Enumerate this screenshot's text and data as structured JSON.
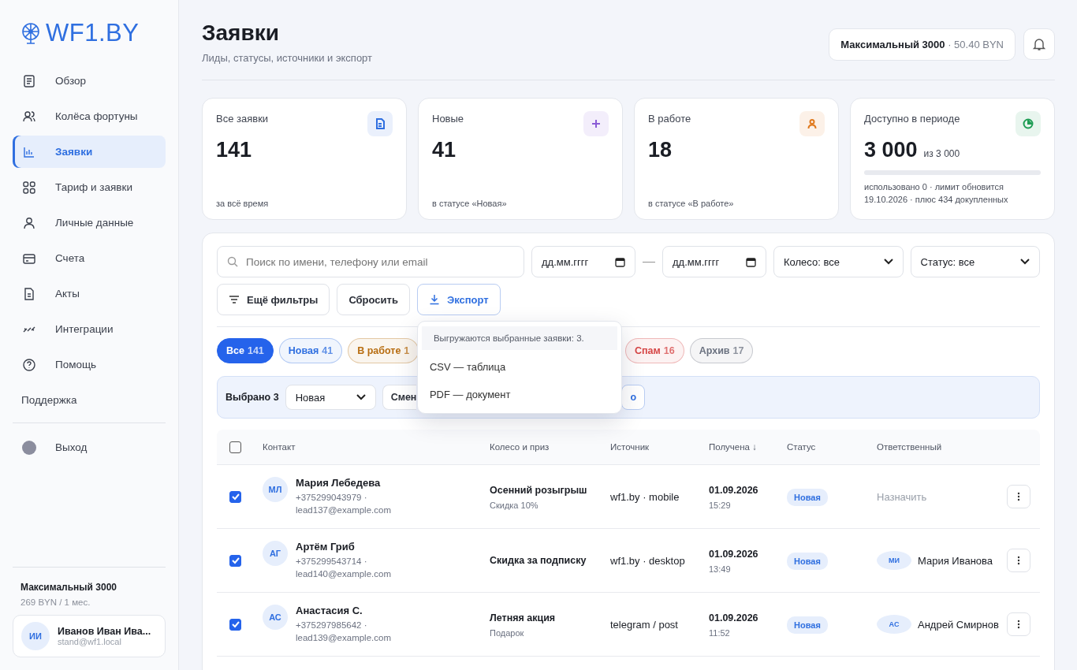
{
  "logo": "WF1.BY",
  "nav": [
    {
      "label": "Обзор",
      "selected": false
    },
    {
      "label": "Колёса фортуны",
      "selected": false
    },
    {
      "label": "Заявки",
      "selected": true
    },
    {
      "label": "Тариф и заявки",
      "selected": false
    },
    {
      "label": "Личные данные",
      "selected": false
    },
    {
      "label": "Счета",
      "selected": false
    },
    {
      "label": "Акты",
      "selected": false
    },
    {
      "label": "Интеграции",
      "selected": false
    },
    {
      "label": "Помощь",
      "selected": false
    }
  ],
  "support": "Поддержка",
  "logout": "Выход",
  "plan": {
    "name": "Максимальный 3000",
    "price": "269 BYN / 1 мес."
  },
  "user": {
    "initials": "ИИ",
    "name": "Иванов Иван Ива...",
    "email": "stand@wf1.local"
  },
  "header": {
    "title": "Заявки",
    "subtitle": "Лиды, статусы, источники и экспорт",
    "plan": "Максимальный 3000",
    "balance": "· 50.40 BYN"
  },
  "stats": [
    {
      "label": "Все заявки",
      "value": "141",
      "note": "за всё время",
      "color": "#2f6fe0"
    },
    {
      "label": "Новые",
      "value": "41",
      "note": "в статусе «Новая»",
      "color": "#8a5cd6"
    },
    {
      "label": "В работе",
      "value": "18",
      "note": "в статусе «В работе»",
      "color": "#e07a1f"
    },
    {
      "label": "Доступно в периоде",
      "value": "3 000",
      "suffix": "из 3 000",
      "level": 0,
      "note": "использовано 0 · лимит обновится 19.10.2026 · плюс 434 докупленных",
      "color": "#1f9d55"
    }
  ],
  "filters": {
    "search_placeholder": "Поиск по имени, телефону или email",
    "date_from": "дд.мм.гггг",
    "date_separator": "—",
    "date_to": "дд.мм.гггг",
    "wheel": "Колесо: все",
    "status": "Статус: все",
    "more": "Ещё фильтры",
    "reset": "Сбросить",
    "export": "Экспорт"
  },
  "export_menu": {
    "hint": "Выгружаются выбранные заявки: 3.",
    "items": [
      "CSV — таблица",
      "PDF — документ"
    ]
  },
  "chips_left": [
    {
      "label": "Все",
      "count": "141",
      "selected": true,
      "color": "#2563eb"
    },
    {
      "label": "Новая",
      "count": "41",
      "selected": false,
      "color": "#2f6fe0"
    },
    {
      "label": "В работе",
      "count": "1",
      "selected": false,
      "color": "#b86e12"
    }
  ],
  "chips_right": [
    {
      "label": "Спам",
      "count": "16",
      "selected": false,
      "color": "#d64545"
    },
    {
      "label": "Архив",
      "count": "17",
      "selected": false,
      "color": "#6b7280"
    }
  ],
  "bulk": {
    "label": "Выбрано 3",
    "status": "Новая",
    "button_left": "Смен",
    "button_right": "о"
  },
  "table": {
    "columns": [
      "Контакт",
      "Колесо и приз",
      "Источник",
      "Получена ↓",
      "Статус",
      "Ответственный"
    ],
    "all_checked": false,
    "rows": [
      {
        "checked": true,
        "initials": "МЛ",
        "name": "Мария Лебедева",
        "phone": "+375299043979 ·",
        "email": "lead137@example.com",
        "wheel": "Осенний розыгрыш",
        "prize": "Скидка 10%",
        "source": "wf1.by · mobile",
        "date": "01.09.2026",
        "time": "15:29",
        "status": "Новая",
        "owner": {
          "kind": "assign",
          "label": "Назначить"
        }
      },
      {
        "checked": true,
        "initials": "АГ",
        "name": "Артём Гриб",
        "phone": "+375299543714 ·",
        "email": "lead140@example.com",
        "wheel": "Скидка за подписку",
        "source": "wf1.by · desktop",
        "date": "01.09.2026",
        "time": "13:49",
        "status": "Новая",
        "owner": {
          "kind": "person",
          "initials": "МИ",
          "label": "Мария Иванова"
        }
      },
      {
        "checked": true,
        "initials": "АС",
        "name": "Анастасия С.",
        "phone": "+375297985642 ·",
        "email": "lead139@example.com",
        "wheel": "Летняя акция",
        "prize": "Подарок",
        "source": "telegram / post",
        "date": "01.09.2026",
        "time": "11:52",
        "status": "Новая",
        "owner": {
          "kind": "person",
          "initials": "АС",
          "label": "Андрей Смирнов"
        }
      }
    ]
  }
}
